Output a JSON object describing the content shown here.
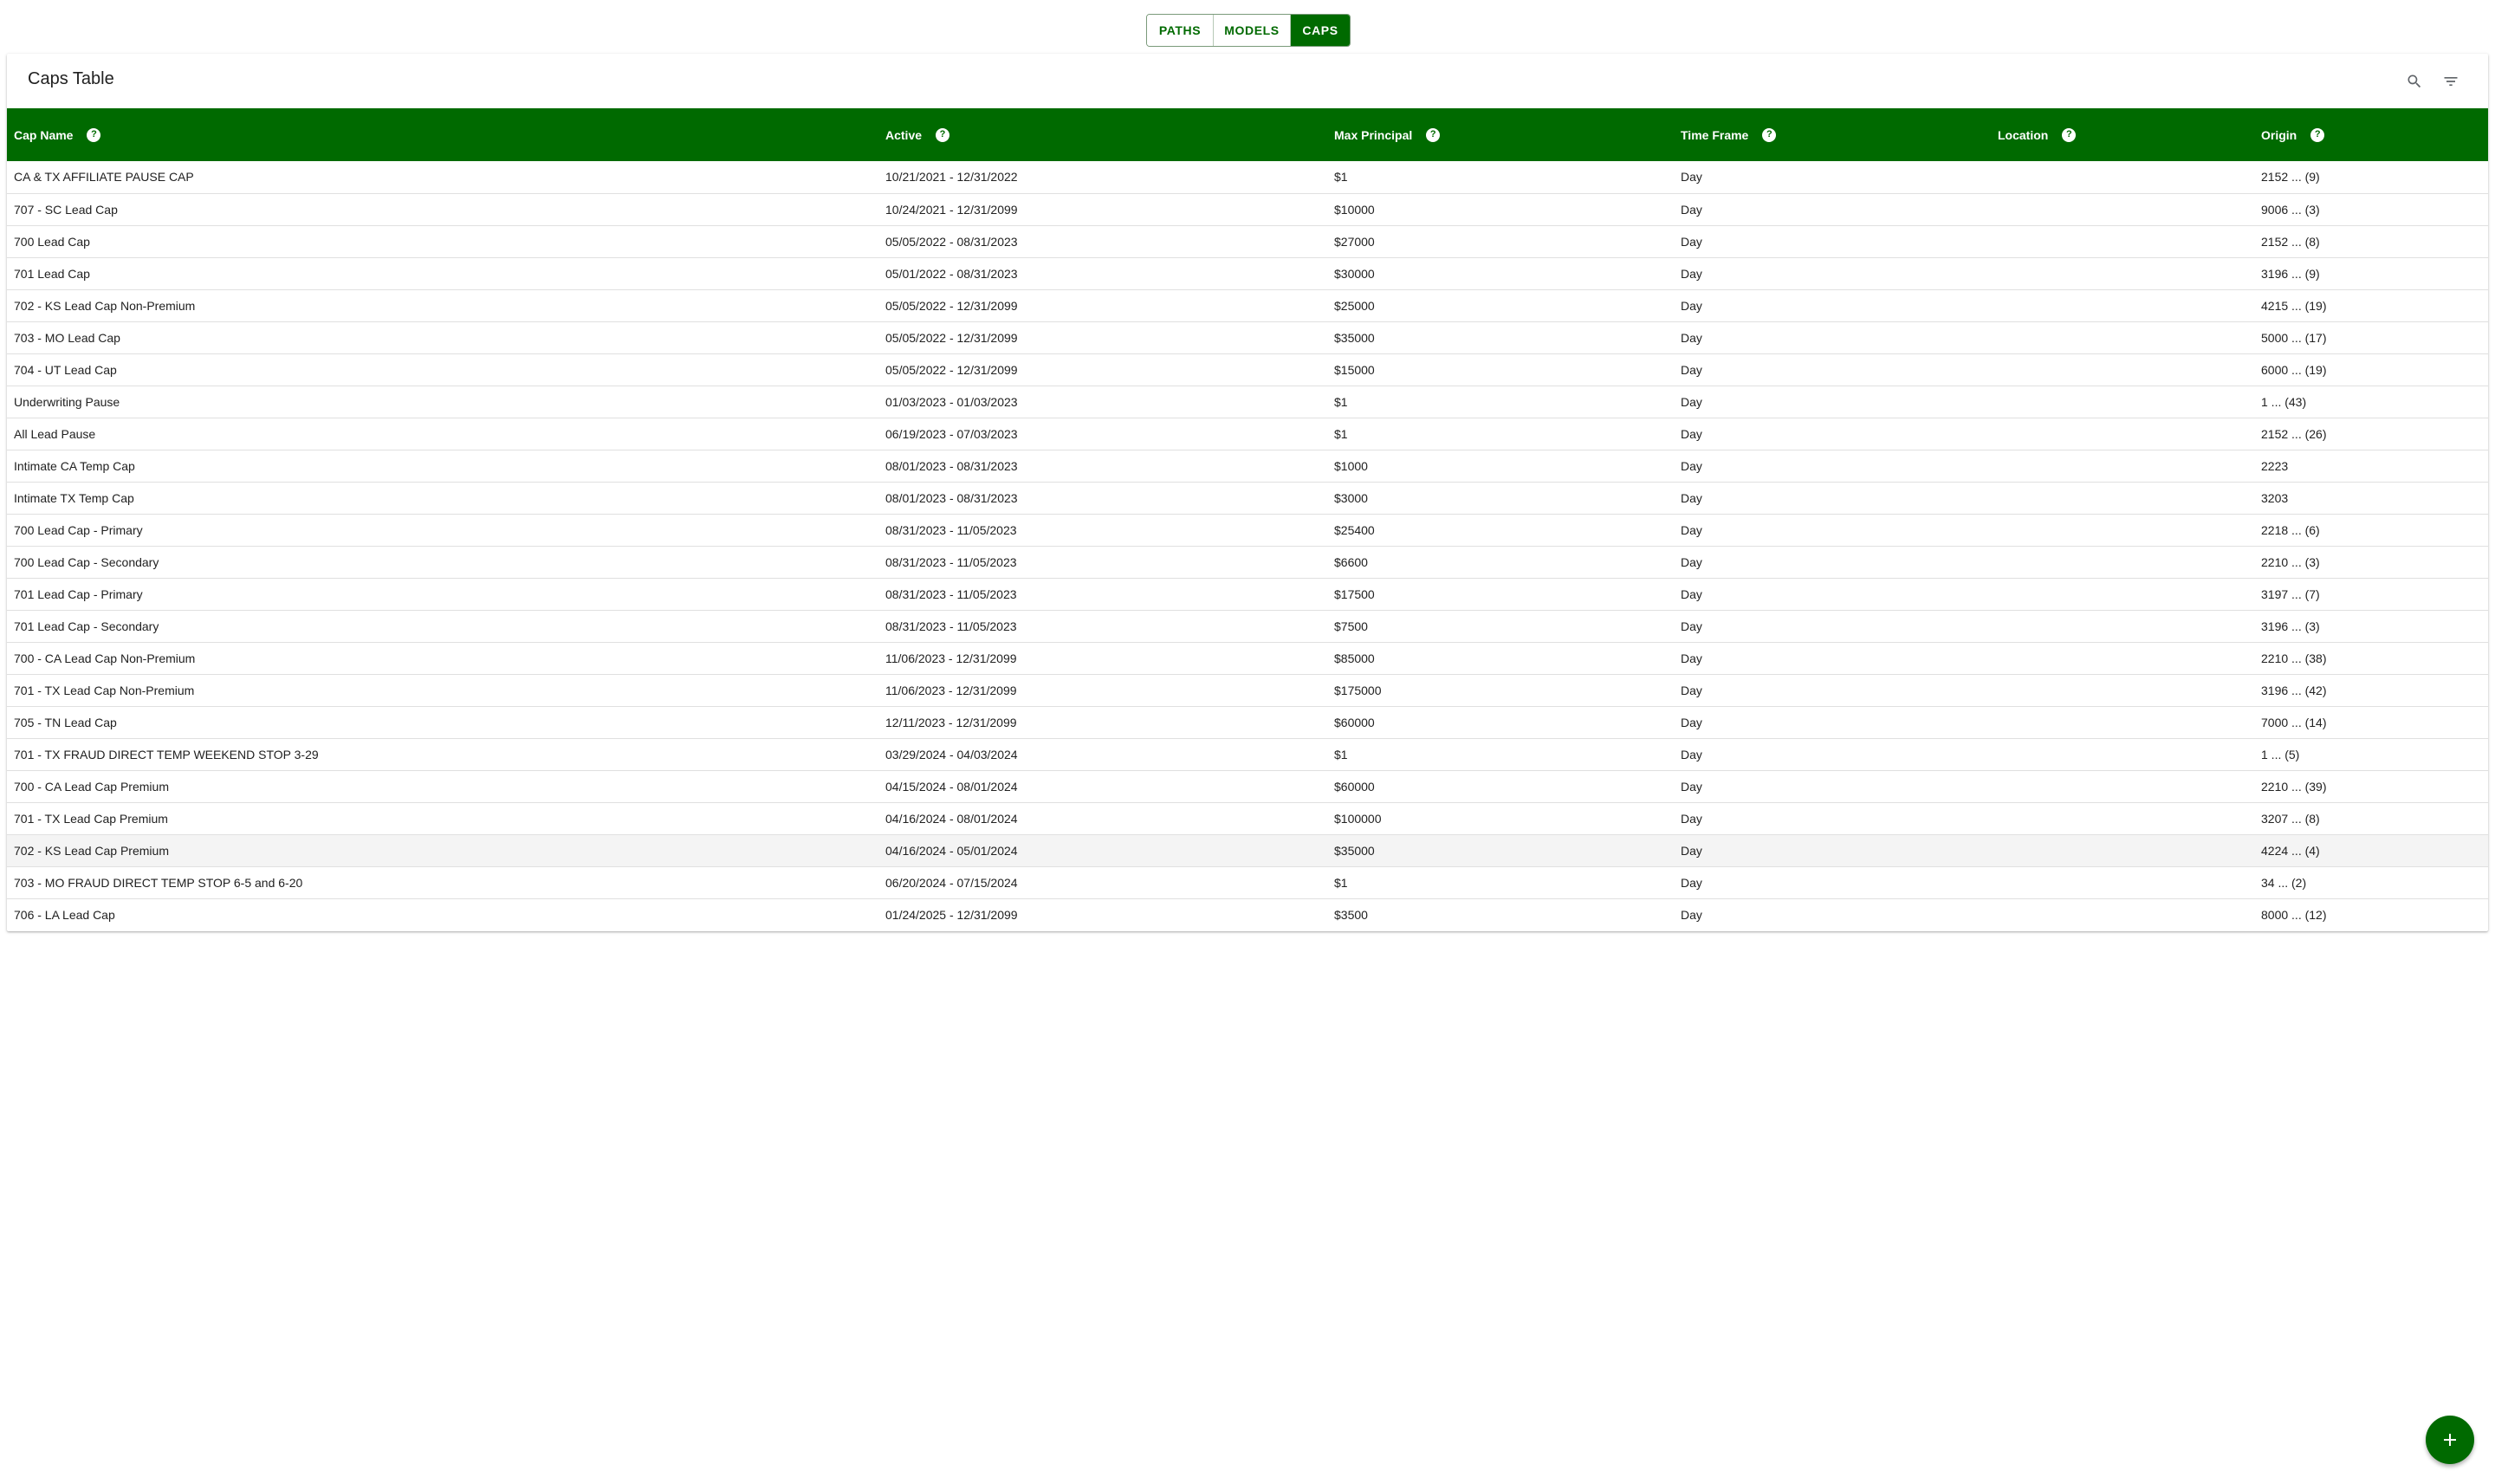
{
  "tabs": [
    {
      "label": "PATHS",
      "active": false
    },
    {
      "label": "MODELS",
      "active": false
    },
    {
      "label": "CAPS",
      "active": true
    }
  ],
  "card": {
    "title": "Caps Table",
    "search_icon": "search-icon",
    "filter_icon": "filter-icon"
  },
  "colors": {
    "primary": "#006a00",
    "header_text": "#ffffff",
    "row_border": "#e0e0e0",
    "highlight_row": "#f4f4f4"
  },
  "table": {
    "headers": [
      {
        "label": "Cap Name"
      },
      {
        "label": "Active"
      },
      {
        "label": "Max Principal"
      },
      {
        "label": "Time Frame"
      },
      {
        "label": "Location"
      },
      {
        "label": "Origin"
      }
    ],
    "rows": [
      [
        "CA & TX AFFILIATE PAUSE CAP",
        "10/21/2021 - 12/31/2022",
        "$1",
        "Day",
        "",
        "2152 ... (9)"
      ],
      [
        "707 - SC Lead Cap",
        "10/24/2021 - 12/31/2099",
        "$10000",
        "Day",
        "",
        "9006 ... (3)"
      ],
      [
        "700 Lead Cap",
        "05/05/2022 - 08/31/2023",
        "$27000",
        "Day",
        "",
        "2152 ... (8)"
      ],
      [
        "701 Lead Cap",
        "05/01/2022 - 08/31/2023",
        "$30000",
        "Day",
        "",
        "3196 ... (9)"
      ],
      [
        "702 - KS Lead Cap Non-Premium",
        "05/05/2022 - 12/31/2099",
        "$25000",
        "Day",
        "",
        "4215 ... (19)"
      ],
      [
        "703 - MO Lead Cap",
        "05/05/2022 - 12/31/2099",
        "$35000",
        "Day",
        "",
        "5000 ... (17)"
      ],
      [
        "704 - UT Lead Cap",
        "05/05/2022 - 12/31/2099",
        "$15000",
        "Day",
        "",
        "6000 ... (19)"
      ],
      [
        "Underwriting Pause",
        "01/03/2023 - 01/03/2023",
        "$1",
        "Day",
        "",
        "1 ... (43)"
      ],
      [
        "All Lead Pause",
        "06/19/2023 - 07/03/2023",
        "$1",
        "Day",
        "",
        "2152 ... (26)"
      ],
      [
        "Intimate CA Temp Cap",
        "08/01/2023 - 08/31/2023",
        "$1000",
        "Day",
        "",
        "2223"
      ],
      [
        "Intimate TX Temp Cap",
        "08/01/2023 - 08/31/2023",
        "$3000",
        "Day",
        "",
        "3203"
      ],
      [
        "700 Lead Cap - Primary",
        "08/31/2023 - 11/05/2023",
        "$25400",
        "Day",
        "",
        "2218 ... (6)"
      ],
      [
        "700 Lead Cap - Secondary",
        "08/31/2023 - 11/05/2023",
        "$6600",
        "Day",
        "",
        "2210 ... (3)"
      ],
      [
        "701 Lead Cap - Primary",
        "08/31/2023 - 11/05/2023",
        "$17500",
        "Day",
        "",
        "3197 ... (7)"
      ],
      [
        "701 Lead Cap - Secondary",
        "08/31/2023 - 11/05/2023",
        "$7500",
        "Day",
        "",
        "3196 ... (3)"
      ],
      [
        "700 - CA Lead Cap Non-Premium",
        "11/06/2023 - 12/31/2099",
        "$85000",
        "Day",
        "",
        "2210 ... (38)"
      ],
      [
        "701 - TX Lead Cap Non-Premium",
        "11/06/2023 - 12/31/2099",
        "$175000",
        "Day",
        "",
        "3196 ... (42)"
      ],
      [
        "705 - TN Lead Cap",
        "12/11/2023 - 12/31/2099",
        "$60000",
        "Day",
        "",
        "7000 ... (14)"
      ],
      [
        "701 - TX FRAUD DIRECT TEMP WEEKEND STOP 3-29",
        "03/29/2024 - 04/03/2024",
        "$1",
        "Day",
        "",
        "1 ... (5)"
      ],
      [
        "700 - CA Lead Cap Premium",
        "04/15/2024 - 08/01/2024",
        "$60000",
        "Day",
        "",
        "2210 ... (39)"
      ],
      [
        "701 - TX Lead Cap Premium",
        "04/16/2024 - 08/01/2024",
        "$100000",
        "Day",
        "",
        "3207 ... (8)"
      ],
      [
        "702 - KS Lead Cap Premium",
        "04/16/2024 - 05/01/2024",
        "$35000",
        "Day",
        "",
        "4224 ... (4)"
      ],
      [
        "703 - MO FRAUD DIRECT TEMP STOP 6-5 and 6-20",
        "06/20/2024 - 07/15/2024",
        "$1",
        "Day",
        "",
        "34 ... (2)"
      ],
      [
        "706 - LA Lead Cap",
        "01/24/2025 - 12/31/2099",
        "$3500",
        "Day",
        "",
        "8000 ... (12)"
      ]
    ]
  },
  "fab": {
    "icon": "plus-icon"
  }
}
